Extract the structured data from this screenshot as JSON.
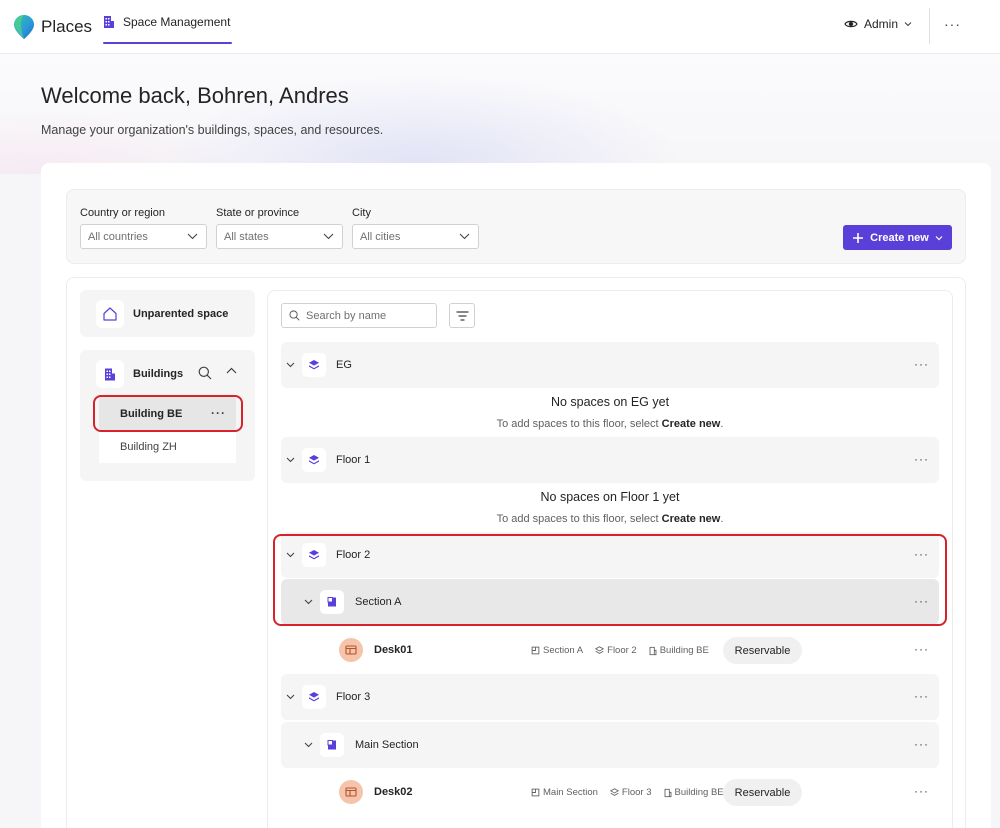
{
  "app": {
    "name": "Places",
    "nav_tab": "Space Management",
    "admin_label": "Admin",
    "more_label": "···"
  },
  "page": {
    "welcome": "Welcome back, Bohren, Andres",
    "subtitle": "Manage your organization's buildings, spaces, and resources."
  },
  "filters": {
    "country_label": "Country or region",
    "country_value": "All countries",
    "state_label": "State or province",
    "state_value": "All states",
    "city_label": "City",
    "city_value": "All cities",
    "create_new_label": "Create new"
  },
  "sidebar": {
    "unparented_label": "Unparented space",
    "buildings_label": "Buildings",
    "buildings": [
      {
        "label": "Building BE",
        "selected": true
      },
      {
        "label": "Building ZH",
        "selected": false
      }
    ],
    "more_label": "···"
  },
  "search": {
    "placeholder": "Search by name"
  },
  "floors": [
    {
      "name": "EG",
      "empty_title": "No spaces on EG yet",
      "empty_prefix": "To add spaces to this floor, select ",
      "empty_action": "Create new",
      "empty_suffix": "."
    },
    {
      "name": "Floor 1",
      "empty_title": "No spaces on Floor 1 yet",
      "empty_prefix": "To add spaces to this floor, select ",
      "empty_action": "Create new",
      "empty_suffix": "."
    },
    {
      "name": "Floor 2"
    },
    {
      "name": "Floor 3"
    }
  ],
  "sections": [
    {
      "name": "Section A"
    },
    {
      "name": "Main Section"
    }
  ],
  "desks": [
    {
      "name": "Desk01",
      "path_section": "Section A",
      "path_floor": "Floor 2",
      "path_building": "Building BE",
      "badge": "Reservable"
    },
    {
      "name": "Desk02",
      "path_section": "Main Section",
      "path_floor": "Floor 3",
      "path_building": "Building BE",
      "badge": "Reservable"
    }
  ],
  "row_more_label": "···",
  "colors": {
    "accent": "#5b3fd9",
    "highlight_outline": "#d6232b",
    "desk_avatar": "#f5c4aa"
  }
}
